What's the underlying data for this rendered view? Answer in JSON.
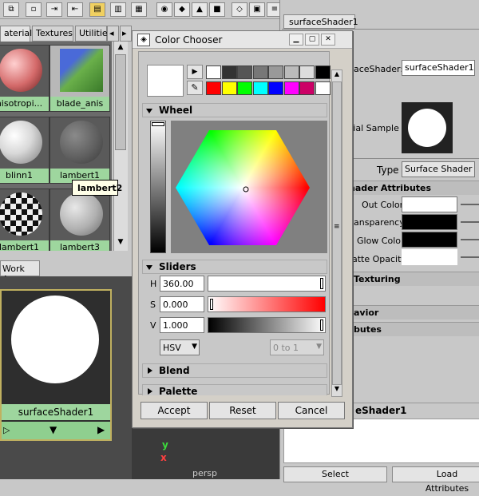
{
  "hypershade": {
    "tabs": [
      "aterials",
      "Textures",
      "Utilities"
    ],
    "swatches": [
      {
        "label": "nisotropi...",
        "color": "#d46a6a"
      },
      {
        "label": "blade_anis",
        "color": "#5a9a4a"
      },
      {
        "label": "blinn1",
        "color": "#d8d8d8"
      },
      {
        "label": "lambert1",
        "color": "#707070"
      },
      {
        "label": "lambert1",
        "color": "#cfcfcf"
      },
      {
        "label": "lambert3",
        "color": "#b0b0b0"
      }
    ],
    "tooltip": "lambert2",
    "work_area_tab": "Work Area",
    "work_node_label": "surfaceShader1"
  },
  "attribute_editor": {
    "tab": "surfaceShader1",
    "shader_label": "aceShader:",
    "shader_name": "surfaceShader1",
    "sample_label": "erial Sample",
    "type_label": "Type",
    "type_value": "Surface Shader",
    "section_attrs": "hader Attributes",
    "out_color": "Out Color",
    "transparency": "ansparency",
    "glow_color": "Glow Color",
    "matte_opacity": "atte Opacity",
    "texturing": "Texturing",
    "behavior": "avior",
    "attributes": "butes",
    "bottom_name": "eShader1",
    "select_btn": "Select",
    "load_btn": "Load Attributes"
  },
  "color_chooser": {
    "title": "Color Chooser",
    "wheel_section": "Wheel",
    "sliders_section": "Sliders",
    "h_label": "H",
    "h_value": "360.00",
    "s_label": "S",
    "s_value": "0.000",
    "v_label": "V",
    "v_value": "1.000",
    "mode": "HSV",
    "range": "0 to 1",
    "blend_section": "Blend",
    "palette_section": "Palette",
    "accept": "Accept",
    "reset": "Reset",
    "cancel": "Cancel",
    "current_color": "#ffffff",
    "palette_row1": [
      "#ffffff",
      "#333333",
      "#555555",
      "#777777",
      "#999999",
      "#bbbbbb",
      "#dddddd",
      "#000000"
    ],
    "palette_row2": [
      "#ff0000",
      "#ffff00",
      "#00ff00",
      "#00ffff",
      "#0000ff",
      "#ff00ff",
      "#cc0066",
      "#ffffff"
    ]
  },
  "viewport": {
    "axis_y": "y",
    "axis_x": "x",
    "persp": "persp"
  }
}
